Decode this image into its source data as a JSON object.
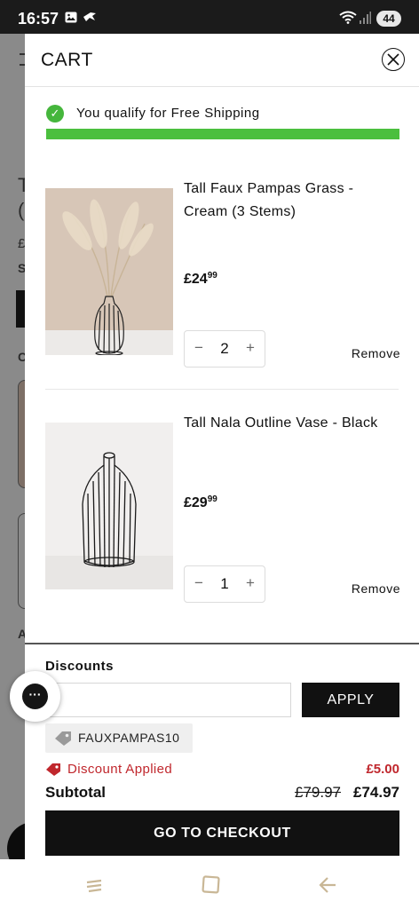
{
  "status_bar": {
    "time": "16:57",
    "battery": "44"
  },
  "cart": {
    "title": "CART",
    "close_icon": "close-icon",
    "shipping": {
      "message": "You qualify for Free Shipping",
      "progress": 1.0,
      "color": "#4bbf3e"
    },
    "items": [
      {
        "name": "Tall Faux Pampas Grass - Cream (3 Stems)",
        "price_main": "£24",
        "price_pence": "99",
        "quantity": "2",
        "remove_label": "Remove"
      },
      {
        "name": "Tall Nala Outline Vase - Black",
        "price_main": "£29",
        "price_pence": "99",
        "quantity": "1",
        "remove_label": "Remove"
      }
    ],
    "qty_minus": "−",
    "qty_plus": "+",
    "discounts": {
      "title": "Discounts",
      "input_placeholder": "",
      "apply_label": "APPLY",
      "code": "FAUXPAMPAS10",
      "applied_label": "Discount Applied",
      "applied_amount": "£5.00"
    },
    "subtotal": {
      "label": "Subtotal",
      "old_price": "£79.97",
      "new_price": "£74.97"
    },
    "checkout_label": "GO TO CHECKOUT"
  },
  "colors": {
    "accent_red": "#c0272d",
    "success_green": "#45b63c",
    "button_black": "#111111"
  }
}
